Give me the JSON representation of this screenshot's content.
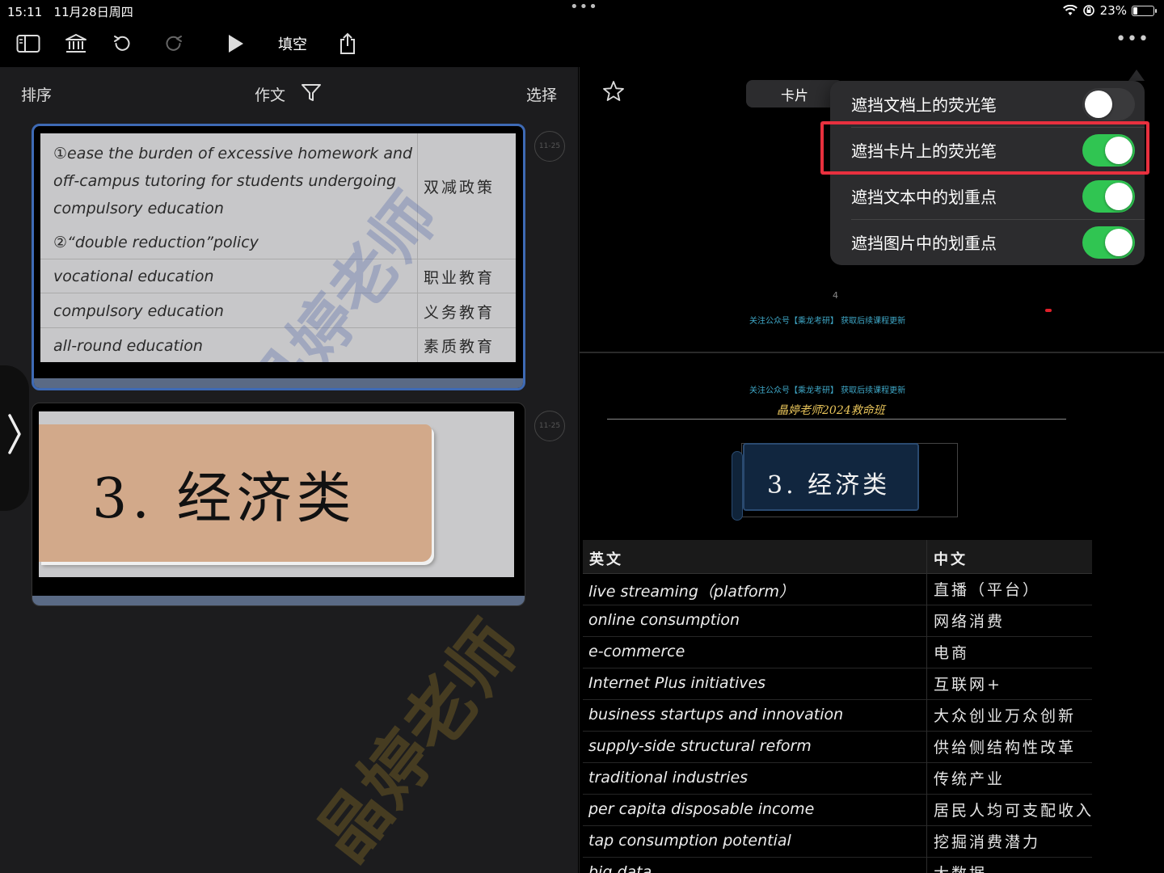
{
  "status": {
    "time": "15:11",
    "date": "11月28日周四",
    "battery": "23%",
    "battery_level": 0.23
  },
  "toolbar": {
    "fill_blank": "填空"
  },
  "icons": {
    "sidebar": "sidebar-icon",
    "library": "library-icon",
    "undo": "undo-icon",
    "redo": "redo-icon",
    "play": "play-icon",
    "share": "share-icon",
    "more": "more-icon",
    "filter": "filter-icon",
    "star": "star-icon"
  },
  "left": {
    "sort": "排序",
    "category": "作文",
    "select": "选择",
    "cards": [
      {
        "date": "11-25",
        "rows": [
          {
            "en_lines": [
              "①ease the burden of excessive homework and",
              "off-campus tutoring for students undergoing",
              "compulsory education",
              "②“double reduction”policy"
            ],
            "zh": "双减政策"
          },
          {
            "en": "vocational education",
            "zh": "职业教育"
          },
          {
            "en": "compulsory education",
            "zh": "义务教育"
          },
          {
            "en": "all-round education",
            "zh": "素质教育"
          }
        ],
        "watermark": "晶婷老师"
      },
      {
        "date": "11-25",
        "title": "3. 经济类"
      }
    ]
  },
  "right": {
    "tab": "卡片",
    "page_number": "4",
    "promo": "关注公众号【乘龙考研】 获取后续课程更新",
    "course": "晶婷老师2024救命班",
    "section": "3. 经济类",
    "table": {
      "head": {
        "en": "英文",
        "zh": "中文"
      },
      "rows": [
        {
          "en": "live streaming（platform）",
          "zh": "直播（平台）"
        },
        {
          "en": "online consumption",
          "zh": "网络消费"
        },
        {
          "en": "e-commerce",
          "zh": "电商"
        },
        {
          "en": "Internet Plus initiatives",
          "zh": "互联网+"
        },
        {
          "en": "business startups and innovation",
          "zh": "大众创业万众创新"
        },
        {
          "en": "supply-side structural reform",
          "zh": "供给侧结构性改革"
        },
        {
          "en": "traditional industries",
          "zh": "传统产业"
        },
        {
          "en": "per capita disposable income",
          "zh": "居民人均可支配收入"
        },
        {
          "en": "tap consumption potential",
          "zh": "挖掘消费潜力"
        },
        {
          "en": "big data",
          "zh": "大数据"
        }
      ]
    },
    "watermark": "晶婷老师"
  },
  "menu": {
    "items": [
      {
        "label": "遮挡文档上的荧光笔",
        "on": false
      },
      {
        "label": "遮挡卡片上的荧光笔",
        "on": true
      },
      {
        "label": "遮挡文本中的划重点",
        "on": true
      },
      {
        "label": "遮挡图片中的划重点",
        "on": true
      }
    ]
  },
  "colors": {
    "accent_blue": "#3e6ab5",
    "toggle_on": "#30c552",
    "highlight_red": "#e8303e",
    "promo_cyan": "#3fa9c9",
    "title_gold": "#e8c45a"
  }
}
